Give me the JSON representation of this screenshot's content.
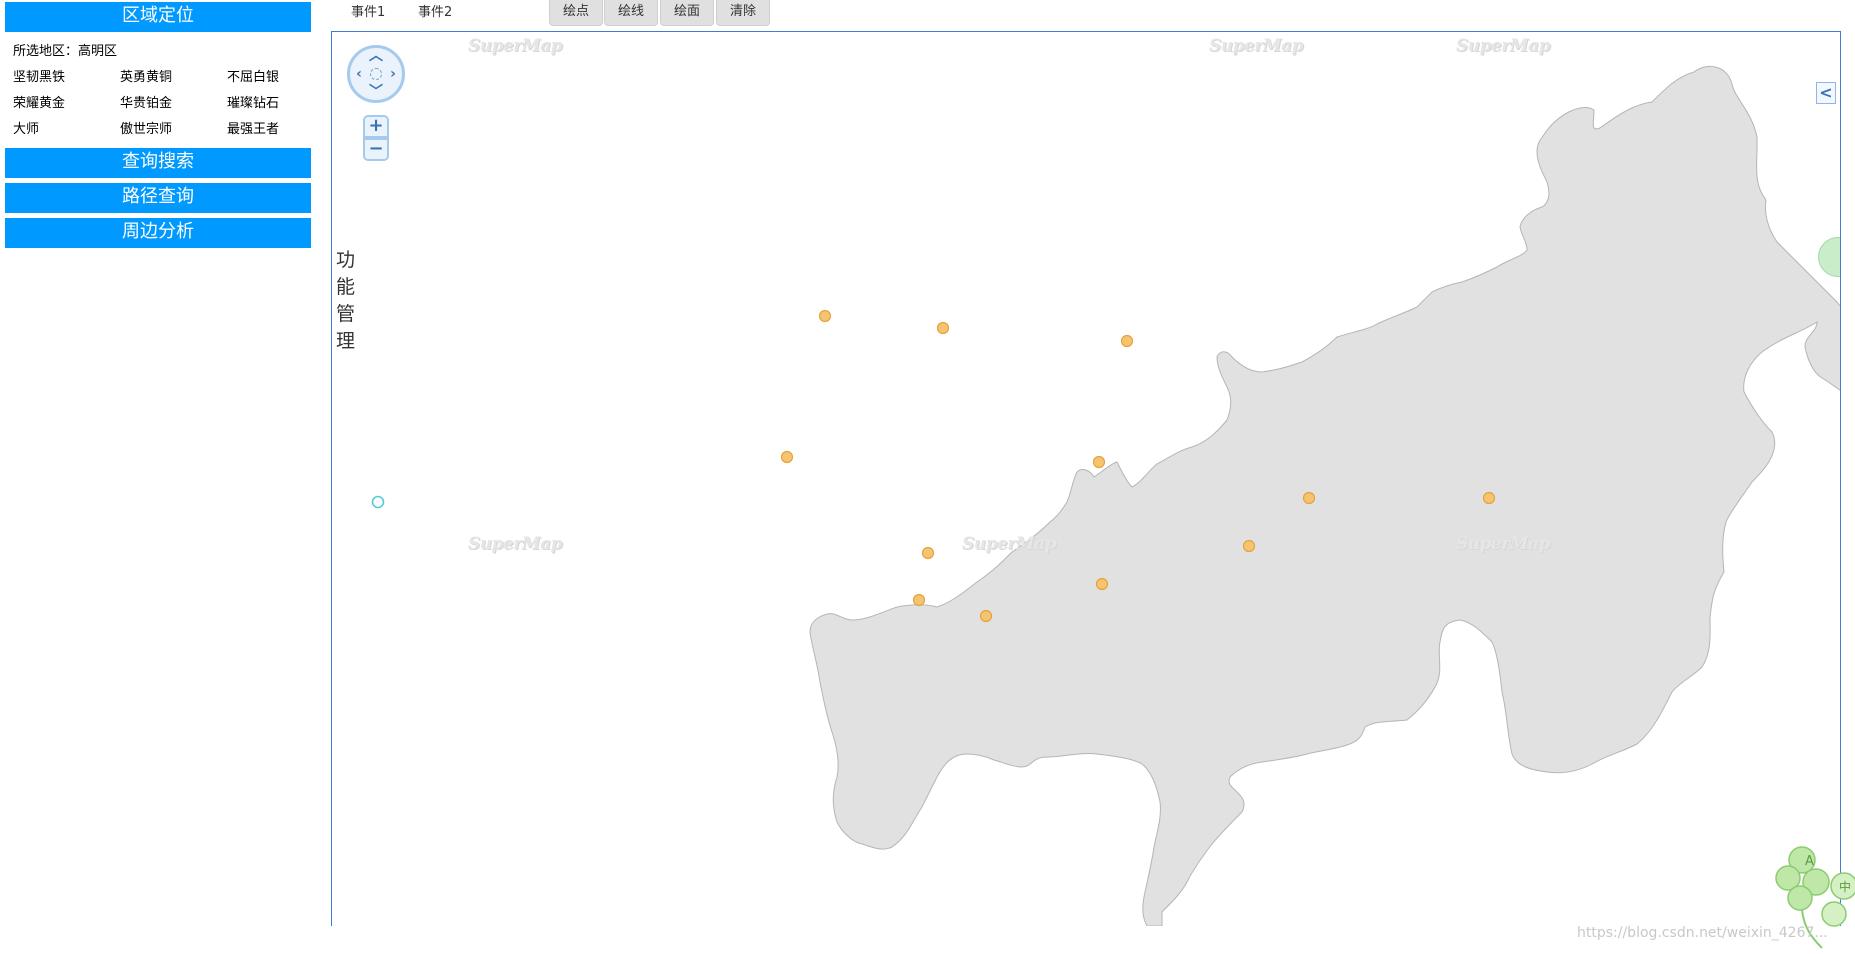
{
  "sidebar": {
    "region_locate_title": "区域定位",
    "selected_region_label": "所选地区：高明区",
    "ranks": [
      "坚韧黑铁",
      "英勇黄铜",
      "不屈白银",
      "荣耀黄金",
      "华贵铂金",
      "璀璨钻石",
      "大师",
      "傲世宗师",
      "最强王者"
    ],
    "query_search_title": "查询搜索",
    "route_query_title": "路径查询",
    "nearby_analysis_title": "周边分析"
  },
  "tabs": {
    "event1": "事件1",
    "event2": "事件2"
  },
  "toolbar": {
    "draw_point": "绘点",
    "draw_line": "绘线",
    "draw_polygon": "绘面",
    "clear": "清除"
  },
  "map": {
    "function_manage": "功能管理",
    "watermark_text": "SuperMap",
    "zoom_in_symbol": "+",
    "zoom_out_symbol": "−",
    "collapse_symbol": "<",
    "region_fill": "#e1e1e1",
    "point_fill": "#f5c471",
    "point_stroke": "#e6a23c",
    "cursor_marker_color": "#5bc8d8"
  },
  "footer": {
    "blog_url": "https://blog.csdn.net/weixin_4267..."
  },
  "colors": {
    "accent": "#0099ff",
    "map_border": "#3a7fd5"
  }
}
